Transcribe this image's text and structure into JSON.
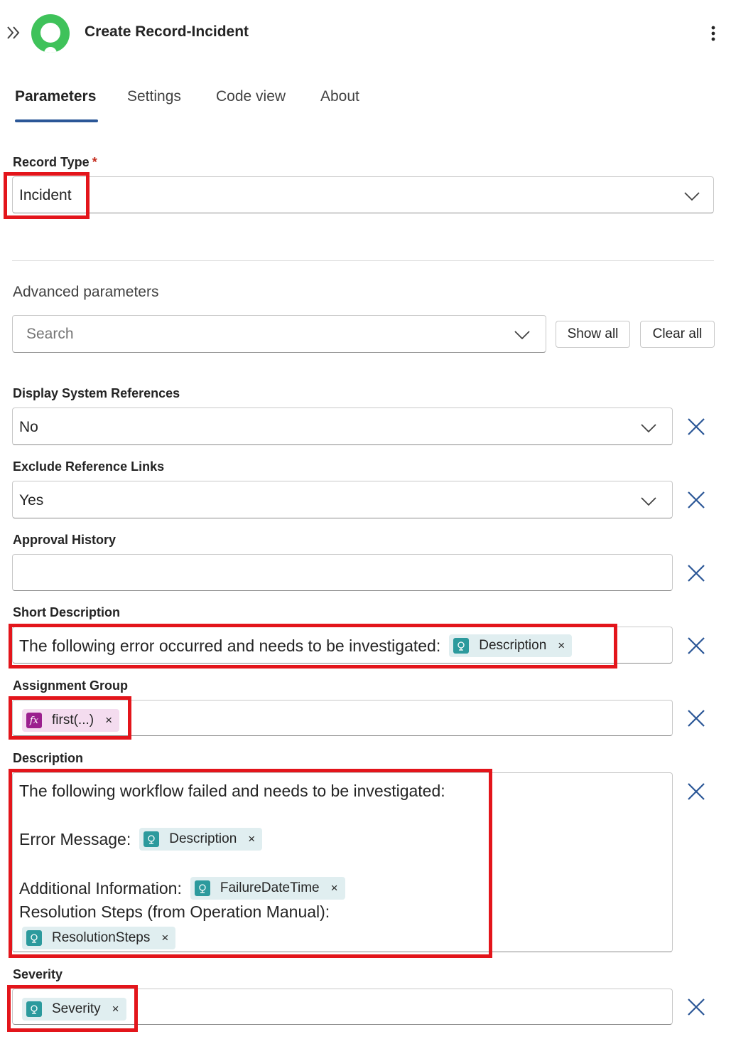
{
  "header": {
    "title": "Create Record-Incident",
    "logo_color": "#3fc25a"
  },
  "tabs": [
    {
      "label": "Parameters",
      "active": true
    },
    {
      "label": "Settings",
      "active": false
    },
    {
      "label": "Code view",
      "active": false
    },
    {
      "label": "About",
      "active": false
    }
  ],
  "record_type": {
    "label": "Record Type",
    "required_mark": "*",
    "value": "Incident"
  },
  "advanced": {
    "title": "Advanced parameters",
    "search_placeholder": "Search",
    "show_all_label": "Show all",
    "clear_all_label": "Clear all"
  },
  "fields": {
    "display_system_references": {
      "label": "Display System References",
      "value": "No"
    },
    "exclude_reference_links": {
      "label": "Exclude Reference Links",
      "value": "Yes"
    },
    "approval_history": {
      "label": "Approval History",
      "value": ""
    },
    "short_description": {
      "label": "Short Description",
      "text": "The following error occurred and needs to be investigated:",
      "token": "Description"
    },
    "assignment_group": {
      "label": "Assignment Group",
      "token": "first(...)"
    },
    "description": {
      "label": "Description",
      "line1": "The following workflow failed and needs to be investigated:",
      "error_label": "Error Message:",
      "error_token": "Description",
      "additional_label": "Additional Information:",
      "additional_token": "FailureDateTime",
      "resolution_label": "Resolution Steps (from Operation Manual):",
      "resolution_token": "ResolutionSteps"
    },
    "severity": {
      "label": "Severity",
      "token": "Severity"
    }
  },
  "token_remove_glyph": "×",
  "fx_glyph": "fx",
  "colors": {
    "accent": "#2b5797",
    "highlight": "#e3151b",
    "token_dynamic": "#e0eef0",
    "token_expression": "#f4dcef",
    "token_dynamic_icon": "#2c9a9d",
    "token_expression_icon": "#9b1f8e",
    "remove_icon": "#2b5797"
  },
  "icons": [
    "double-chevron-right-icon",
    "more-vertical-icon",
    "chevron-down-icon",
    "close-icon",
    "dynamic-content-icon",
    "expression-icon"
  ]
}
